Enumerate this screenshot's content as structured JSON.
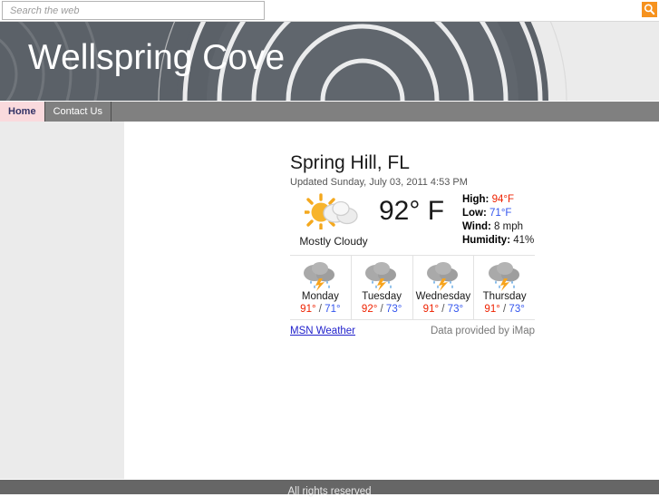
{
  "search": {
    "placeholder": "Search the web",
    "go_icon": "search-icon",
    "accent_color": "#f6921e"
  },
  "banner": {
    "site_title": "Wellspring Cove",
    "dark_color": "#5b6168",
    "light_color": "#ebebeb",
    "arc_color": "#ffffff"
  },
  "nav": {
    "items": [
      {
        "label": "Home",
        "active": true
      },
      {
        "label": "Contact Us",
        "active": false
      }
    ],
    "bar_color": "#808080",
    "active_bg": "#fadadd",
    "active_text": "#333366"
  },
  "weather": {
    "city": "Spring Hill, FL",
    "updated": "Updated Sunday, July 03, 2011 4:53 PM",
    "condition_icon": "sun-behind-cloud-icon",
    "condition": "Mostly Cloudy",
    "temperature": "92° F",
    "stats": [
      {
        "label": "High:",
        "value": "94°F",
        "color": "#ee2200"
      },
      {
        "label": "Low:",
        "value": "71°F",
        "color": "#3355ee"
      },
      {
        "label": "Wind:",
        "value": "8 mph",
        "color": "#1a1a1a"
      },
      {
        "label": "Humidity:",
        "value": "41%",
        "color": "#1a1a1a"
      }
    ],
    "forecast": [
      {
        "day": "Monday",
        "icon": "thunderstorm-icon",
        "high": "91°",
        "low": "71°",
        "separator": "/"
      },
      {
        "day": "Tuesday",
        "icon": "thunderstorm-icon",
        "high": "92°",
        "low": "73°",
        "separator": "/"
      },
      {
        "day": "Wednesday",
        "icon": "thunderstorm-icon",
        "high": "91°",
        "low": "73°",
        "separator": "/"
      },
      {
        "day": "Thursday",
        "icon": "thunderstorm-icon",
        "high": "91°",
        "low": "73°",
        "separator": "/"
      }
    ],
    "source_link": "MSN Weather",
    "credit": "Data provided by iMap"
  },
  "footer": {
    "text": "All rights reserved"
  }
}
